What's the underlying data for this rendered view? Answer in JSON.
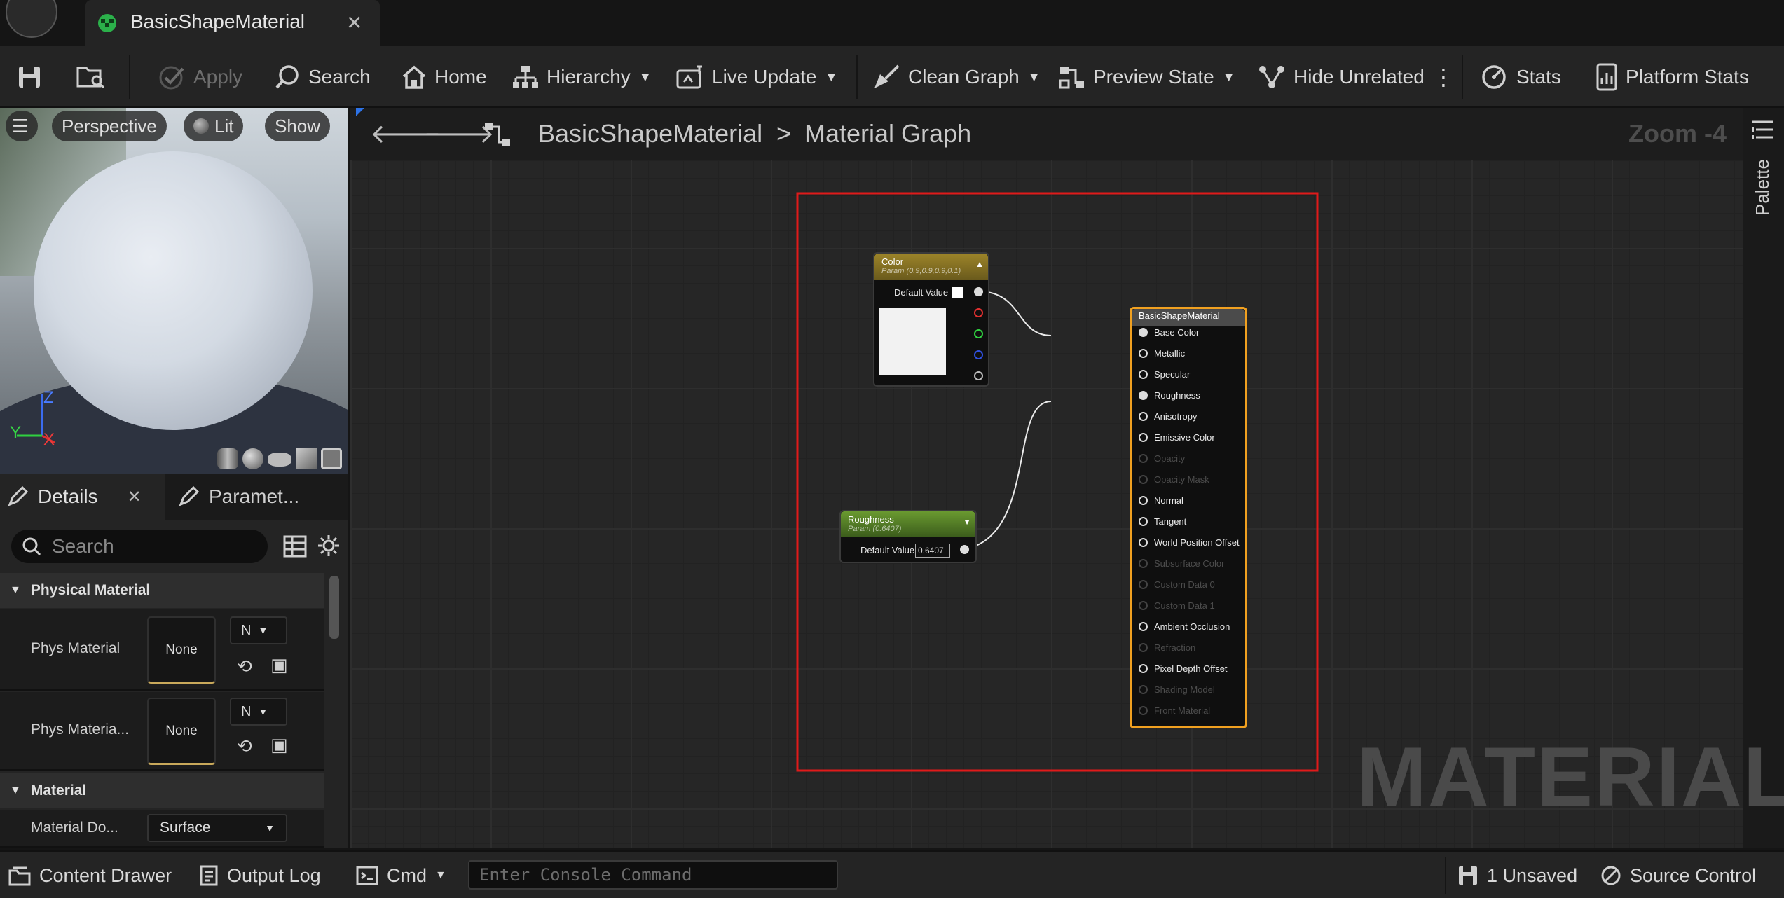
{
  "tab": {
    "title": "BasicShapeMaterial",
    "close": "✕"
  },
  "toolbar": {
    "apply": "Apply",
    "search": "Search",
    "home": "Home",
    "hierarchy": "Hierarchy",
    "live_update": "Live Update",
    "clean_graph": "Clean Graph",
    "preview_state": "Preview State",
    "hide_unrelated": "Hide Unrelated",
    "stats": "Stats",
    "platform_stats": "Platform Stats"
  },
  "viewport": {
    "perspective": "Perspective",
    "lit": "Lit",
    "show": "Show",
    "axis_z": "Z",
    "axis_y": "Y",
    "axis_x": "X"
  },
  "panel_tabs": {
    "details": "Details",
    "details_close": "✕",
    "parameters": "Paramet..."
  },
  "details": {
    "search_placeholder": "Search",
    "physical_material": {
      "heading": "Physical Material",
      "rows": [
        {
          "label": "Phys Material",
          "value": "None",
          "combo": "N"
        },
        {
          "label": "Phys Materia...",
          "value": "None",
          "combo": "N"
        }
      ]
    },
    "material": {
      "heading": "Material",
      "domain_label": "Material Do...",
      "domain_value": "Surface"
    }
  },
  "graph": {
    "breadcrumb_root": "BasicShapeMaterial",
    "breadcrumb_sep": ">",
    "breadcrumb_leaf": "Material Graph",
    "zoom": "Zoom -4",
    "palette": "Palette",
    "watermark": "MATERIAL",
    "color_node": {
      "title": "Color",
      "subtitle": "Param (0.9,0.9,0.9,0.1)",
      "default_label": "Default Value",
      "preview_color": "#f2f2f2"
    },
    "roughness_node": {
      "title": "Roughness",
      "subtitle": "Param (0.6407)",
      "default_label": "Default Value",
      "value": "0.6407"
    },
    "material_node": {
      "title": "BasicShapeMaterial",
      "pins": [
        {
          "label": "Base Color",
          "enabled": true,
          "connected": true
        },
        {
          "label": "Metallic",
          "enabled": true,
          "connected": false
        },
        {
          "label": "Specular",
          "enabled": true,
          "connected": false
        },
        {
          "label": "Roughness",
          "enabled": true,
          "connected": true
        },
        {
          "label": "Anisotropy",
          "enabled": true,
          "connected": false
        },
        {
          "label": "Emissive Color",
          "enabled": true,
          "connected": false
        },
        {
          "label": "Opacity",
          "enabled": false,
          "connected": false
        },
        {
          "label": "Opacity Mask",
          "enabled": false,
          "connected": false
        },
        {
          "label": "Normal",
          "enabled": true,
          "connected": false
        },
        {
          "label": "Tangent",
          "enabled": true,
          "connected": false
        },
        {
          "label": "World Position Offset",
          "enabled": true,
          "connected": false
        },
        {
          "label": "Subsurface Color",
          "enabled": false,
          "connected": false
        },
        {
          "label": "Custom Data 0",
          "enabled": false,
          "connected": false
        },
        {
          "label": "Custom Data 1",
          "enabled": false,
          "connected": false
        },
        {
          "label": "Ambient Occlusion",
          "enabled": true,
          "connected": false
        },
        {
          "label": "Refraction",
          "enabled": false,
          "connected": false
        },
        {
          "label": "Pixel Depth Offset",
          "enabled": true,
          "connected": false
        },
        {
          "label": "Shading Model",
          "enabled": false,
          "connected": false
        },
        {
          "label": "Front Material",
          "enabled": false,
          "connected": false
        }
      ]
    }
  },
  "statusbar": {
    "content_drawer": "Content Drawer",
    "output_log": "Output Log",
    "cmd": "Cmd",
    "console_placeholder": "Enter Console Command",
    "unsaved": "1 Unsaved",
    "source_control": "Source Control"
  },
  "colors": {
    "accent_orange": "#f0a020",
    "selection_red": "#e01a1a",
    "color_node_header": "#8a7424",
    "roughness_node_header": "#5b8a2a"
  }
}
